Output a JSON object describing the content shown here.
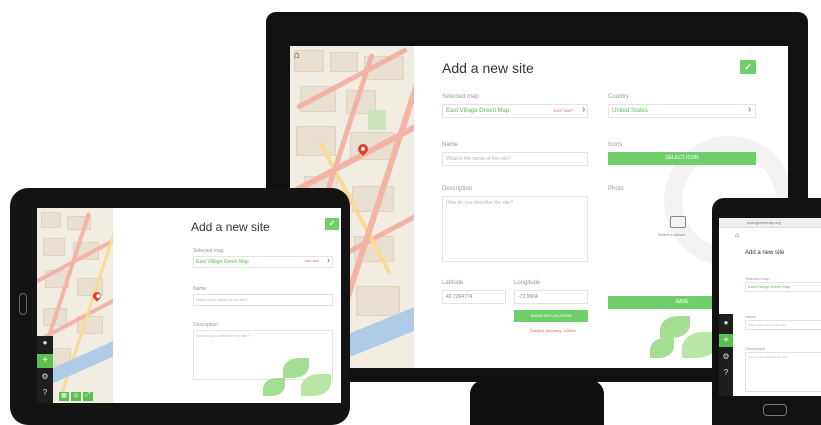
{
  "page": {
    "title": "Add a new site",
    "selected_map_label": "Selected map",
    "selected_map_value": "East Village Green Map",
    "selected_map_badge": "EDIT MAP",
    "country_label": "Country",
    "country_value": "United States",
    "name_label": "Name",
    "name_placeholder": "What is the name of the site?",
    "icons_label": "Icons",
    "select_icons_button": "SELECT ICON",
    "description_label": "Description",
    "description_placeholder": "How do you describe the site?",
    "photo_label": "Photo",
    "photo_select": "Select a picture",
    "latitude_label": "Latitude",
    "latitude_value": "40.7264774",
    "longitude_label": "Longitude",
    "longitude_value": "-73.9904",
    "geolocate_button": "SHOW MY LOCATION",
    "accuracy_note": "Position accuracy: 1200m",
    "save_button": "SAVE",
    "save_check": "✓",
    "phone_url": "opengreenmap.org"
  },
  "sidebar_icons": [
    "home-icon",
    "user-icon",
    "plus-icon",
    "settings-icon",
    "help-icon"
  ],
  "accent_color": "#6fd06a"
}
